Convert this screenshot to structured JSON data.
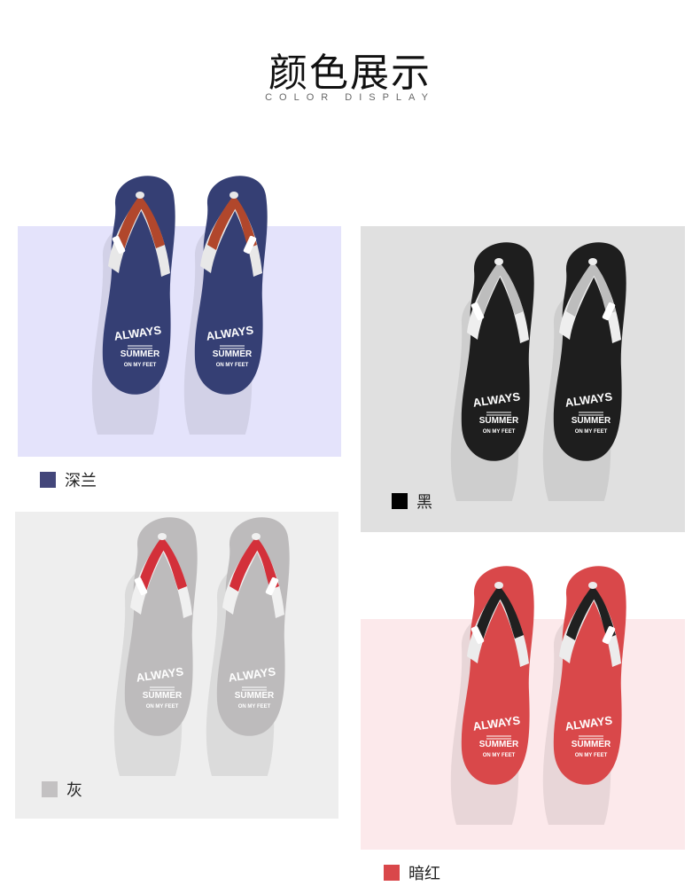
{
  "header": {
    "title": "颜色展示",
    "subtitle": "COLOR DISPLAY"
  },
  "variants": [
    {
      "id": "navy",
      "label": "深兰",
      "swatch": "#43467a",
      "panel_bg": "#e4e3fb",
      "sole": "#353f74",
      "strap_top": "#b1472c",
      "strap_bottom": "#e8e8e8",
      "print": "#ffffff"
    },
    {
      "id": "black",
      "label": "黑",
      "swatch": "#000000",
      "panel_bg": "#e0e0e0",
      "sole": "#1e1e1e",
      "strap_top": "#bdbdbd",
      "strap_bottom": "#eeeeee",
      "print": "#ffffff"
    },
    {
      "id": "grey",
      "label": "灰",
      "swatch": "#c3c1c2",
      "panel_bg": "#eeeeee",
      "sole": "#bdbbbc",
      "strap_top": "#d3303a",
      "strap_bottom": "#f0f0f0",
      "print": "#ffffff"
    },
    {
      "id": "darkred",
      "label": "暗红",
      "swatch": "#d9474a",
      "panel_bg": "#fce9eb",
      "sole": "#d9484a",
      "strap_top": "#202020",
      "strap_bottom": "#ececec",
      "print": "#ffffff"
    }
  ],
  "sole_print": {
    "line1": "ALWAYS",
    "line2": "SUMMER",
    "line3": "ON MY FEET",
    "strap_tag": "WEIGHSOPE"
  }
}
